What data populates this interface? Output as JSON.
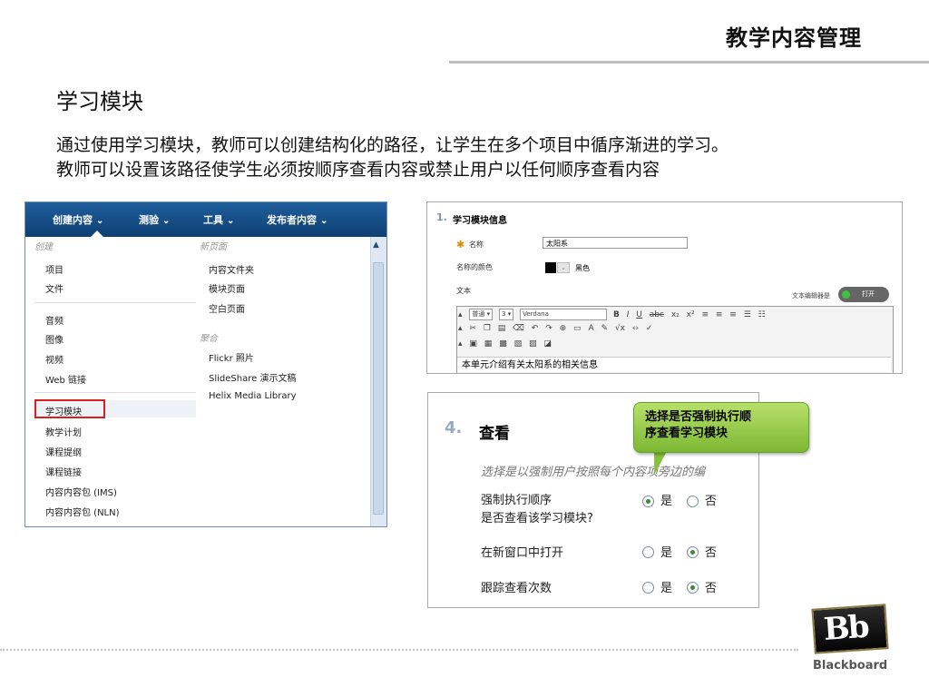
{
  "header": {
    "title": "教学内容管理"
  },
  "section": {
    "title": "学习模块",
    "desc_line1": "通过使用学习模块，教师可以创建结构化的路径，让学生在多个项目中循序渐进的学习。",
    "desc_line2": "教师可以设置该路径使学生必须按顺序查看内容或禁止用户以任何顺序查看内容"
  },
  "menu": {
    "tabs": [
      "创建内容",
      "测验",
      "工具",
      "发布者内容"
    ],
    "col1_head": "创建",
    "col1_items": [
      "项目",
      "文件",
      "音频",
      "图像",
      "视频",
      "Web 链接",
      "学习模块",
      "教学计划",
      "课程提纲",
      "课程链接",
      "内容内容包 (IMS)",
      "内容内容包 (NLN)"
    ],
    "col2_head1": "新页面",
    "col2_items1": [
      "内容文件夹",
      "模块页面",
      "空白页面"
    ],
    "col2_head2": "聚合",
    "col2_items2": [
      "Flickr 照片",
      "SlideShare 演示文稿",
      "Helix Media Library"
    ]
  },
  "info": {
    "num": "1.",
    "title": "学习模块信息",
    "name_label": "名称",
    "name_value": "太阳系",
    "color_label": "名称的颜色",
    "color_value": "黑色",
    "text_label": "文本",
    "editor_mode_label": "文本编辑器是",
    "toggle_label": "打开",
    "toolbar_style": "普通",
    "toolbar_size": "3",
    "toolbar_font": "Verdana",
    "editor_content": "本单元介绍有关太阳系的相关信息"
  },
  "view": {
    "num": "4.",
    "title": "查看",
    "hint": "选择是以强制用户按照每个内容项旁边的编",
    "opt1_line1": "强制执行顺序",
    "opt1_line2": "是否查看该学习模块?",
    "opt2": "在新窗口中打开",
    "opt3": "跟踪查看次数",
    "yes": "是",
    "no": "否",
    "opt1_selected": "yes",
    "opt2_selected": "no",
    "opt3_selected": "no"
  },
  "callout": {
    "line1": "选择是否强制执行顺",
    "line2": "序查看学习模块"
  },
  "logo": {
    "mark": "Bb",
    "name": "Blackboard"
  },
  "colors": {
    "menu_bar": "#0e3f72",
    "highlight": "#d32020",
    "callout": "#8cc63f"
  }
}
